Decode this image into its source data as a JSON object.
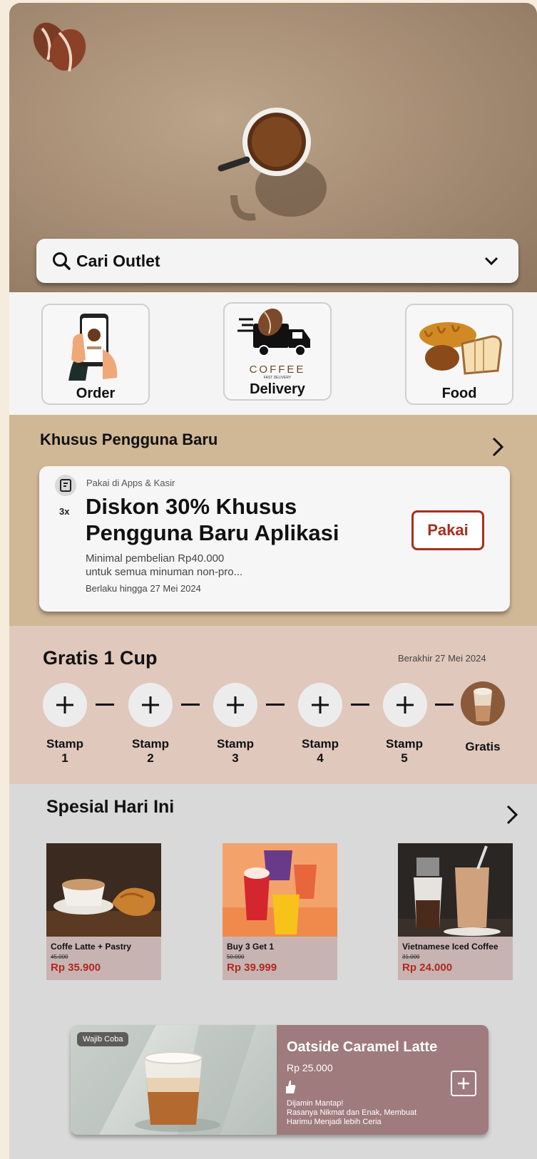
{
  "search": {
    "label": "Cari Outlet"
  },
  "services": [
    {
      "label": "Order"
    },
    {
      "label": "Delivery",
      "brand": "COFFEE",
      "tagline": "FAST DELIVERY"
    },
    {
      "label": "Food"
    }
  ],
  "promo": {
    "section_title": "Khusus Pengguna Baru",
    "where": "Pakai di Apps & Kasir",
    "times": "3x",
    "headline": "Diskon 30% Khusus Pengguna Baru Aplikasi",
    "min_line1": "Minimal pembelian Rp40.000",
    "min_line2": "untuk semua minuman non-pro...",
    "valid": "Berlaku hingga 27 Mei 2024",
    "button": "Pakai"
  },
  "stamps": {
    "title": "Gratis 1 Cup",
    "ends": "Berakhir 27 Mei 2024",
    "items": [
      {
        "line1": "Stamp",
        "line2": "1"
      },
      {
        "line1": "Stamp",
        "line2": "2"
      },
      {
        "line1": "Stamp",
        "line2": "3"
      },
      {
        "line1": "Stamp",
        "line2": "4"
      },
      {
        "line1": "Stamp",
        "line2": "5"
      }
    ],
    "reward": "Gratis"
  },
  "special": {
    "title": "Spesial Hari Ini",
    "items": [
      {
        "name": "Coffe Latte + Pastry",
        "old_price": "45.000",
        "price": "Rp 35.900"
      },
      {
        "name": "Buy 3 Get 1",
        "old_price": "50.000",
        "price": "Rp 39.999"
      },
      {
        "name": "Vietnamese Iced Coffee",
        "old_price": "31.000",
        "price": "Rp 24.000"
      }
    ],
    "feature": {
      "badge": "Wajib Coba",
      "title": "Oatside Caramel Latte",
      "price": "Rp 25.000",
      "desc_line1": "Dijamin Mantap!",
      "desc_line2": "Rasanya Nikmat dan Enak, Membuat",
      "desc_line3": "Harimu Menjadi lebih Ceria"
    }
  },
  "colors": {
    "accent": "#a5301f",
    "promo_bg": "#d0b796",
    "stamps_bg": "#e0c8bd",
    "feature_bg": "#9f7b7e"
  }
}
